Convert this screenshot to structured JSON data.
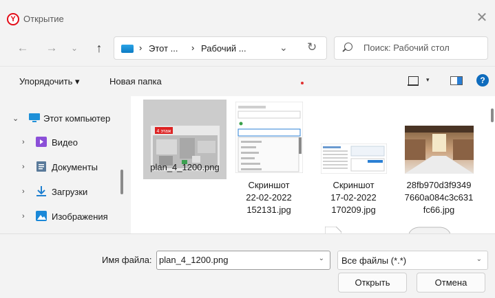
{
  "window": {
    "title": "Открытие",
    "app_icon": "yandex-browser-icon",
    "close_glyph": "✕"
  },
  "nav": {
    "back": "←",
    "forward": "→",
    "recent": "⌄",
    "up": "↑",
    "breadcrumb": [
      "Этот ...",
      "Рабочий ..."
    ],
    "breadcrumb_sep": "›",
    "dropdown_glyph": "⌄",
    "refresh_glyph": "↻",
    "search_placeholder": "Поиск: Рабочий стол"
  },
  "toolbar": {
    "organize": "Упорядочить ▾",
    "new_folder": "Новая папка",
    "view_dropdown": "▾",
    "help": "?"
  },
  "sidebar": {
    "items": [
      {
        "label": "Этот компьютер",
        "chevron": "⌄",
        "icon": "computer-icon",
        "color": "#1e90d8"
      },
      {
        "label": "Видео",
        "chevron": "›",
        "icon": "video-folder-icon",
        "color": "#8b4fd8"
      },
      {
        "label": "Документы",
        "chevron": "›",
        "icon": "documents-folder-icon",
        "color": "#5a7a9a"
      },
      {
        "label": "Загрузки",
        "chevron": "›",
        "icon": "downloads-folder-icon",
        "color": "#1e7fd0"
      },
      {
        "label": "Изображения",
        "chevron": "›",
        "icon": "pictures-folder-icon",
        "color": "#1a88d8"
      }
    ]
  },
  "files": [
    {
      "name": "plan_4_1200.png",
      "selected": true,
      "thumb_text": "4 этаж"
    },
    {
      "name_lines": [
        "Скриншот",
        "22-02-2022",
        "152131.jpg"
      ],
      "selected": false
    },
    {
      "name_lines": [
        "Скриншот",
        "17-02-2022",
        "170209.jpg"
      ],
      "selected": false
    },
    {
      "name_lines": [
        "28fb970d3f9349",
        "7660a084c3c631",
        "fc66.jpg"
      ],
      "selected": false
    }
  ],
  "bottom": {
    "filename_label": "Имя файла:",
    "filename_value": "plan_4_1200.png",
    "filetype": "Все файлы (*.*)",
    "dd_glyph": "⌄",
    "open": "Открыть",
    "cancel": "Отмена"
  },
  "colors": {
    "accent": "#0f6cbd",
    "selected_bg": "#cccccc"
  }
}
